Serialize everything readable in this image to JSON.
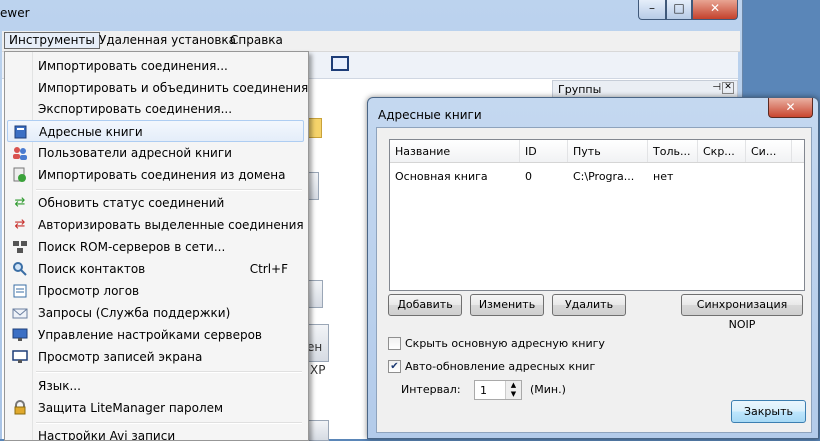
{
  "window": {
    "title_fragment": "ewer",
    "controls": {
      "minimize": "–",
      "maximize": "□",
      "close": "✕"
    }
  },
  "menubar": [
    "Инструменты",
    "Удаленная установка",
    "Справка"
  ],
  "groups_panel": {
    "title": "Группы",
    "pin": "⊣",
    "close": "✕"
  },
  "background_fragments": {
    "frag1": "ен",
    "frag2": "XP"
  },
  "tools_menu": {
    "items": [
      {
        "label": "Импортировать соединения...",
        "icon": "",
        "shortcut": ""
      },
      {
        "label": "Импортировать и объединить соединения...",
        "icon": "",
        "shortcut": ""
      },
      {
        "label": "Экспортировать соединения...",
        "icon": "",
        "shortcut": ""
      },
      {
        "label": "Адресные книги",
        "icon": "address-book-icon",
        "shortcut": "",
        "highlighted": true
      },
      {
        "label": "Пользователи адресной книги",
        "icon": "users-icon",
        "shortcut": ""
      },
      {
        "label": "Импортировать соединения из домена",
        "icon": "domain-import-icon",
        "shortcut": ""
      },
      {
        "label": "Обновить статус соединений",
        "icon": "refresh-icon",
        "shortcut": ""
      },
      {
        "label": "Авторизировать выделенные соединения",
        "icon": "authorize-icon",
        "shortcut": ""
      },
      {
        "label": "Поиск ROM-серверов в сети...",
        "icon": "network-search-icon",
        "shortcut": ""
      },
      {
        "label": "Поиск контактов",
        "icon": "search-icon",
        "shortcut": "Ctrl+F"
      },
      {
        "label": "Просмотр логов",
        "icon": "log-icon",
        "shortcut": ""
      },
      {
        "label": "Запросы (Служба поддержки)",
        "icon": "mail-icon",
        "shortcut": ""
      },
      {
        "label": "Управление настройками серверов",
        "icon": "server-settings-icon",
        "shortcut": ""
      },
      {
        "label": "Просмотр записей экрана",
        "icon": "screen-record-icon",
        "shortcut": ""
      },
      {
        "label": "Язык...",
        "icon": "",
        "shortcut": ""
      },
      {
        "label": "Защита LiteManager паролем",
        "icon": "lock-icon",
        "shortcut": ""
      },
      {
        "label": "Настройки Avi записи",
        "icon": "",
        "shortcut": ""
      }
    ]
  },
  "dialog": {
    "title": "Адресные книги",
    "close": "✕",
    "columns": [
      "Название",
      "ID",
      "Путь",
      "Толь...",
      "Скр...",
      "Си..."
    ],
    "rows": [
      [
        "Основная книга",
        "0",
        "C:\\Progra...",
        "нет",
        "",
        ""
      ]
    ],
    "buttons": {
      "add": "Добавить",
      "edit": "Изменить",
      "delete": "Удалить",
      "sync": "Синхронизация NOIP",
      "close": "Закрыть"
    },
    "hide_main_book": {
      "label": "Скрыть основную адресную книгу",
      "checked": false
    },
    "auto_update": {
      "label": "Авто-обновление адресных книг",
      "checked": true
    },
    "interval": {
      "label": "Интервал:",
      "value": "1",
      "unit": "(Мин.)"
    }
  }
}
